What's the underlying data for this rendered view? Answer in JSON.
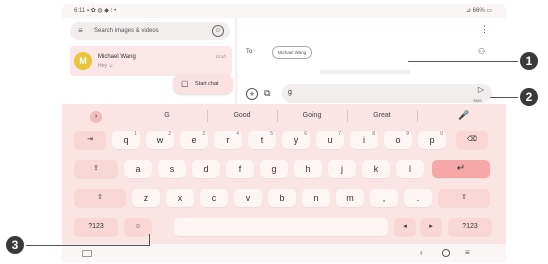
{
  "status": {
    "time": "6:11",
    "icons": "▪ ✿ ◍ ◆ ⁝ •",
    "right": "⊿ 66% ▭"
  },
  "inbox": {
    "search_placeholder": "Search images & videos",
    "menu_icon": "≡",
    "profile_icon": "☺",
    "conversation": {
      "avatar_letter": "M",
      "name": "Michael Wang",
      "preview": "Hey ☺",
      "draft": "Draft"
    },
    "start_chat_label": "Start chat",
    "start_chat_icon": "▢"
  },
  "compose": {
    "more_icon": "⋮",
    "to_label": "To",
    "recipient_chip": "Michael Wang",
    "add_person_icon": "⚇",
    "add_icon": "+",
    "gallery_icon": "⧉",
    "message_value": "g",
    "send_icon": "▷",
    "send_sub": "SMS"
  },
  "keyboard": {
    "expand_icon": "›",
    "suggestions": [
      "G",
      "Good",
      "Going",
      "Great"
    ],
    "mic_icon": "🎤",
    "row1": [
      {
        "k": "⇥",
        "fn": true
      },
      {
        "k": "q",
        "s": "1"
      },
      {
        "k": "w",
        "s": "2"
      },
      {
        "k": "e",
        "s": "3"
      },
      {
        "k": "r",
        "s": "4"
      },
      {
        "k": "t",
        "s": "5"
      },
      {
        "k": "y",
        "s": "6"
      },
      {
        "k": "u",
        "s": "7"
      },
      {
        "k": "i",
        "s": "8"
      },
      {
        "k": "o",
        "s": "9"
      },
      {
        "k": "p",
        "s": "0"
      },
      {
        "k": "⌫",
        "fn": true
      }
    ],
    "row2": [
      {
        "k": "⇪",
        "fn": true
      },
      {
        "k": "a"
      },
      {
        "k": "s"
      },
      {
        "k": "d"
      },
      {
        "k": "f"
      },
      {
        "k": "g"
      },
      {
        "k": "h"
      },
      {
        "k": "j"
      },
      {
        "k": "k"
      },
      {
        "k": "l"
      },
      {
        "k": "↵",
        "enter": true
      }
    ],
    "row3": [
      {
        "k": "⇧",
        "fn": true
      },
      {
        "k": "z"
      },
      {
        "k": "x"
      },
      {
        "k": "c"
      },
      {
        "k": "v"
      },
      {
        "k": "b"
      },
      {
        "k": "n"
      },
      {
        "k": "m"
      },
      {
        "k": ","
      },
      {
        "k": "."
      },
      {
        "k": "⇧",
        "fn": true
      }
    ],
    "row4": [
      {
        "k": "?123",
        "fn": true
      },
      {
        "k": "☺",
        "fn": true
      },
      {
        "k": ""
      },
      {
        "k": "◂",
        "fn": true
      },
      {
        "k": "▸",
        "fn": true
      },
      {
        "k": "?123",
        "fn": true
      }
    ]
  },
  "navbar": {
    "back": "‹",
    "recent": "≡"
  },
  "callouts": [
    "1",
    "2",
    "3"
  ]
}
